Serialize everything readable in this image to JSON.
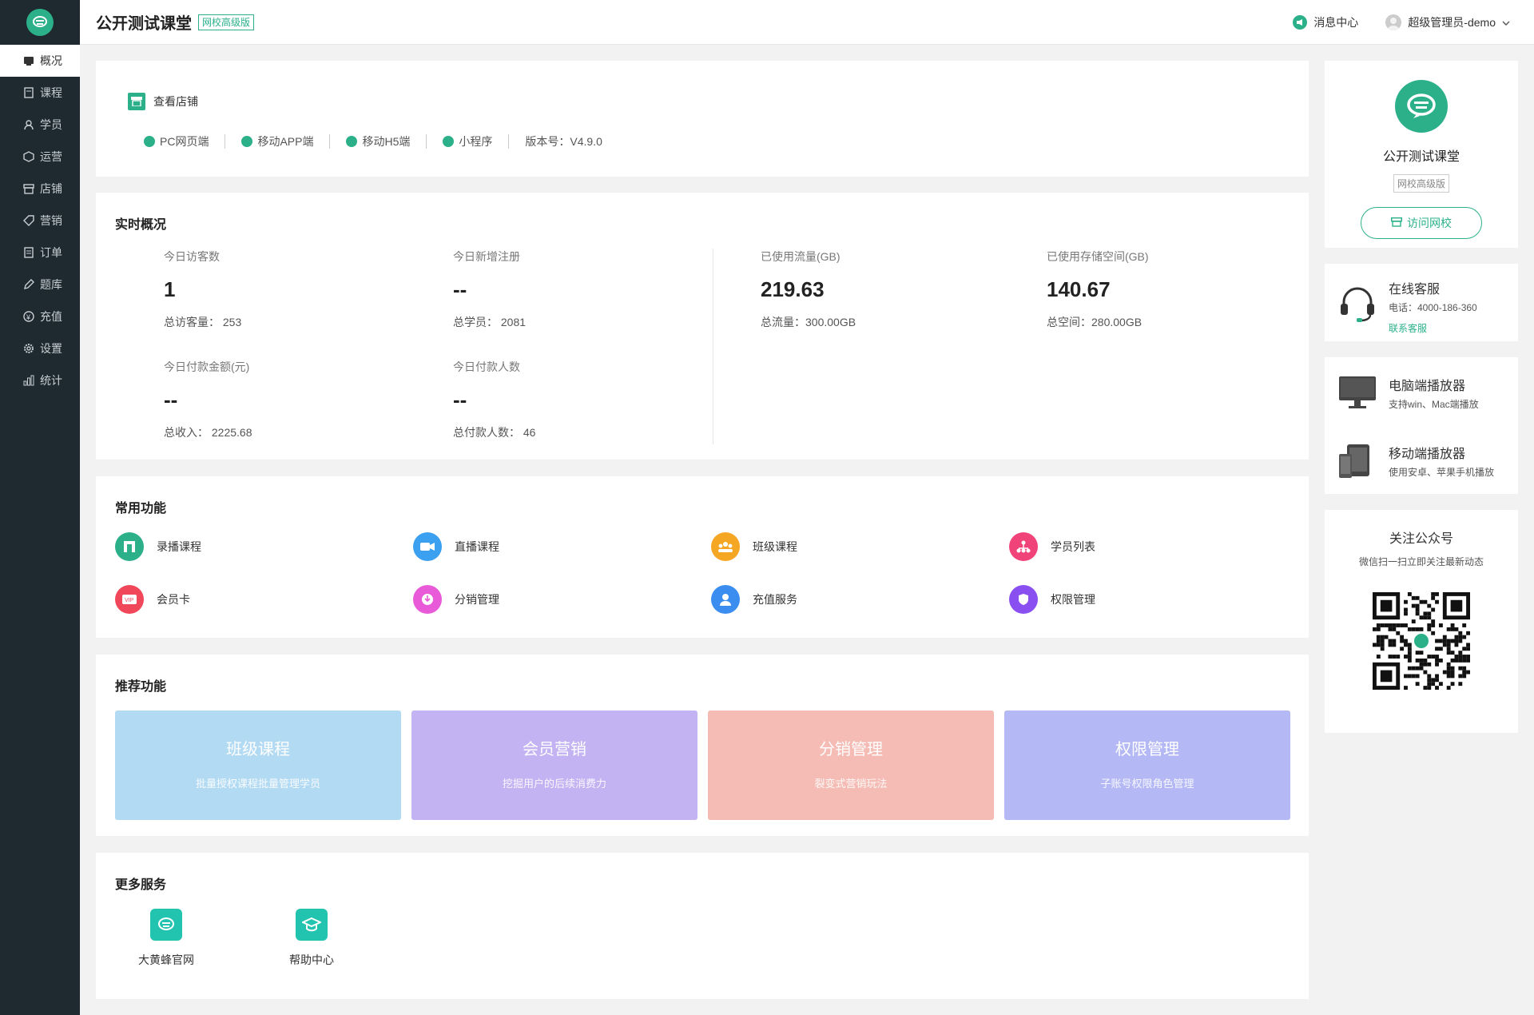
{
  "header": {
    "school_title": "公开测试课堂",
    "edition": "网校高级版",
    "messages_label": "消息中心",
    "user_label": "超级管理员-demo"
  },
  "sidebar": {
    "items": [
      {
        "label": "概况",
        "icon": "dashboard-icon",
        "active": true
      },
      {
        "label": "课程",
        "icon": "book-icon"
      },
      {
        "label": "学员",
        "icon": "user-icon"
      },
      {
        "label": "运营",
        "icon": "cube-icon"
      },
      {
        "label": "店铺",
        "icon": "store-icon"
      },
      {
        "label": "营销",
        "icon": "tag-icon"
      },
      {
        "label": "订单",
        "icon": "order-icon"
      },
      {
        "label": "题库",
        "icon": "pen-icon"
      },
      {
        "label": "充值",
        "icon": "coin-icon"
      },
      {
        "label": "设置",
        "icon": "gear-icon"
      },
      {
        "label": "统计",
        "icon": "stats-icon"
      }
    ]
  },
  "shop": {
    "view_label": "查看店铺",
    "platforms": [
      "PC网页端",
      "移动APP端",
      "移动H5端",
      "小程序"
    ],
    "version": "版本号：V4.9.0"
  },
  "realtime": {
    "title": "实时概况",
    "stats": [
      {
        "label": "今日访客数",
        "value": "1",
        "total": "总访客量： 253"
      },
      {
        "label": "今日新增注册",
        "value": "--",
        "total": "总学员： 2081"
      },
      {
        "label": "已使用流量(GB)",
        "value": "219.63",
        "total": "总流量：300.00GB"
      },
      {
        "label": "已使用存储空间(GB)",
        "value": "140.67",
        "total": "总空间：280.00GB"
      },
      {
        "label": "今日付款金额(元)",
        "value": "--",
        "total": "总收入： 2225.68"
      },
      {
        "label": "今日付款人数",
        "value": "--",
        "total": "总付款人数： 46"
      }
    ]
  },
  "common": {
    "title": "常用功能",
    "items": [
      {
        "label": "录播课程",
        "color": "#2bb08a"
      },
      {
        "label": "直播课程",
        "color": "#3ba0f0"
      },
      {
        "label": "班级课程",
        "color": "#f5a623"
      },
      {
        "label": "学员列表",
        "color": "#f0437a"
      },
      {
        "label": "会员卡",
        "color": "#f0475a"
      },
      {
        "label": "分销管理",
        "color": "#e85ad8"
      },
      {
        "label": "充值服务",
        "color": "#3b8ef0"
      },
      {
        "label": "权限管理",
        "color": "#8a4ff0"
      }
    ]
  },
  "recommended": {
    "title": "推荐功能",
    "tiles": [
      {
        "title": "班级课程",
        "subtitle": "批量授权课程批量管理学员",
        "color": "#b3daf3"
      },
      {
        "title": "会员营销",
        "subtitle": "挖掘用户的后续消费力",
        "color": "#c3b3f2"
      },
      {
        "title": "分销管理",
        "subtitle": "裂变式营销玩法",
        "color": "#f4bcb4"
      },
      {
        "title": "权限管理",
        "subtitle": "子账号权限角色管理",
        "color": "#b4b8f4"
      }
    ]
  },
  "more": {
    "title": "更多服务",
    "items": [
      {
        "label": "大黄蜂官网"
      },
      {
        "label": "帮助中心"
      }
    ]
  },
  "profile": {
    "name": "公开测试课堂",
    "badge": "网校高级版",
    "visit_label": "访问网校"
  },
  "service": {
    "title": "在线客服",
    "phone": "电话：4000-186-360",
    "link": "联系客服"
  },
  "players": [
    {
      "title": "电脑端播放器",
      "subtitle": "支持win、Mac端播放"
    },
    {
      "title": "移动端播放器",
      "subtitle": "使用安卓、苹果手机播放"
    }
  ],
  "wechat": {
    "title": "关注公众号",
    "subtitle": "微信扫一扫立即关注最新动态"
  },
  "colors": {
    "accent": "#2bb08a",
    "sidebar_bg": "#1f2a30"
  }
}
